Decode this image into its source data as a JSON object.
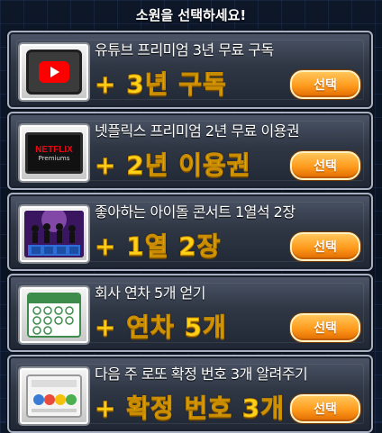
{
  "header": {
    "title": "소원을 선택하세요!"
  },
  "button_label": "선택",
  "cards": [
    {
      "title": "유튜브 프리미엄 3년 무료 구독",
      "reward": "+ 3년 구독",
      "icon": "youtube-tv-icon"
    },
    {
      "title": "넷플릭스 프리미엄 2년 무료 이용권",
      "reward": "+ 2년 이용권",
      "icon": "netflix-tv-icon",
      "icon_text": [
        "NETFLIX",
        "Premiums"
      ]
    },
    {
      "title": "좋아하는 아이돌 콘서트 1열석 2장",
      "reward": "+ 1열 2장",
      "icon": "concert-icon"
    },
    {
      "title": "회사 연차 5개 얻기",
      "reward": "+ 연차 5개",
      "icon": "calendar-icon"
    },
    {
      "title": "다음 주 로또 확정 번호 3개 알려주기",
      "reward": "+ 확정 번호 3개",
      "icon": "lotto-ticket-icon"
    }
  ],
  "colors": {
    "reward": "#ffd21a",
    "button": "#ff9a1c",
    "youtube": "#ff0000",
    "netflix": "#e50914"
  }
}
